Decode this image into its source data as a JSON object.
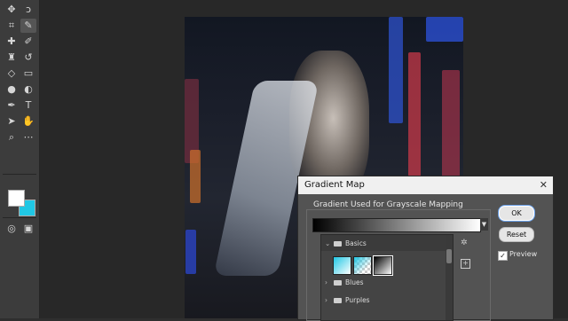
{
  "toolbar": {
    "tools": [
      {
        "name": "move-tool-icon",
        "glyph": "✥"
      },
      {
        "name": "lasso-tool-icon",
        "glyph": "ↄ"
      },
      {
        "name": "crop-tool-icon",
        "glyph": "⌗"
      },
      {
        "name": "eyedropper-tool-icon",
        "glyph": "✎"
      },
      {
        "name": "healing-brush-icon",
        "glyph": "✚"
      },
      {
        "name": "brush-tool-icon",
        "glyph": "✐"
      },
      {
        "name": "clone-stamp-icon",
        "glyph": "♜"
      },
      {
        "name": "history-brush-icon",
        "glyph": "↺"
      },
      {
        "name": "eraser-tool-icon",
        "glyph": "◇"
      },
      {
        "name": "gradient-tool-icon",
        "glyph": "▭"
      },
      {
        "name": "blur-tool-icon",
        "glyph": "●"
      },
      {
        "name": "dodge-tool-icon",
        "glyph": "◐"
      },
      {
        "name": "pen-tool-icon",
        "glyph": "✒"
      },
      {
        "name": "type-tool-icon",
        "glyph": "T"
      },
      {
        "name": "path-selection-icon",
        "glyph": "➤"
      },
      {
        "name": "hand-tool-icon",
        "glyph": "✋"
      },
      {
        "name": "zoom-tool-icon",
        "glyph": "⌕"
      },
      {
        "name": "edit-toolbar-icon",
        "glyph": "⋯"
      },
      {
        "name": "quick-mask-icon",
        "glyph": "◎"
      },
      {
        "name": "screen-mode-icon",
        "glyph": "▣"
      }
    ],
    "foreground_color": "#ffffff",
    "background_color": "#20c7e4"
  },
  "dialog": {
    "title": "Gradient Map",
    "close_label": "✕",
    "section_label": "Gradient Used for Grayscale Mapping",
    "ok_label": "OK",
    "reset_label": "Reset",
    "preview_label": "Preview",
    "preview_checked": true,
    "picker": {
      "folders": [
        {
          "label": "Basics",
          "expanded": true
        },
        {
          "label": "Blues",
          "expanded": false
        },
        {
          "label": "Purples",
          "expanded": false
        }
      ],
      "swatches": [
        {
          "name": "foreground-to-background",
          "colors": [
            "#20c7e4",
            "#ffffff"
          ]
        },
        {
          "name": "foreground-to-transparent",
          "colors": [
            "#20c7e4",
            "transparent"
          ]
        },
        {
          "name": "black-white",
          "colors": [
            "#000000",
            "#ffffff"
          ]
        }
      ]
    }
  }
}
